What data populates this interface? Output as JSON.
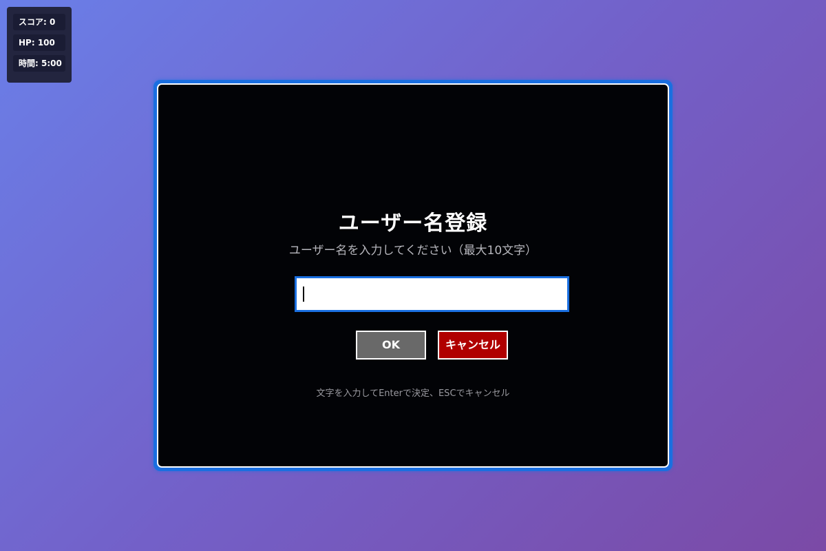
{
  "hud": {
    "score": "スコア: 0",
    "hp": "HP: 100",
    "time": "時間: 5:00"
  },
  "dialog": {
    "title": "ユーザー名登録",
    "subtitle": "ユーザー名を入力してください（最大10文字）",
    "input_value": "",
    "ok_label": "OK",
    "cancel_label": "キャンセル",
    "hint": "文字を入力してEnterで決定、ESCでキャンセル"
  },
  "colors": {
    "accent": "#1a6fe0",
    "ok_button": "#696969",
    "cancel_button": "#b00000",
    "screen_bg": "#020306"
  }
}
